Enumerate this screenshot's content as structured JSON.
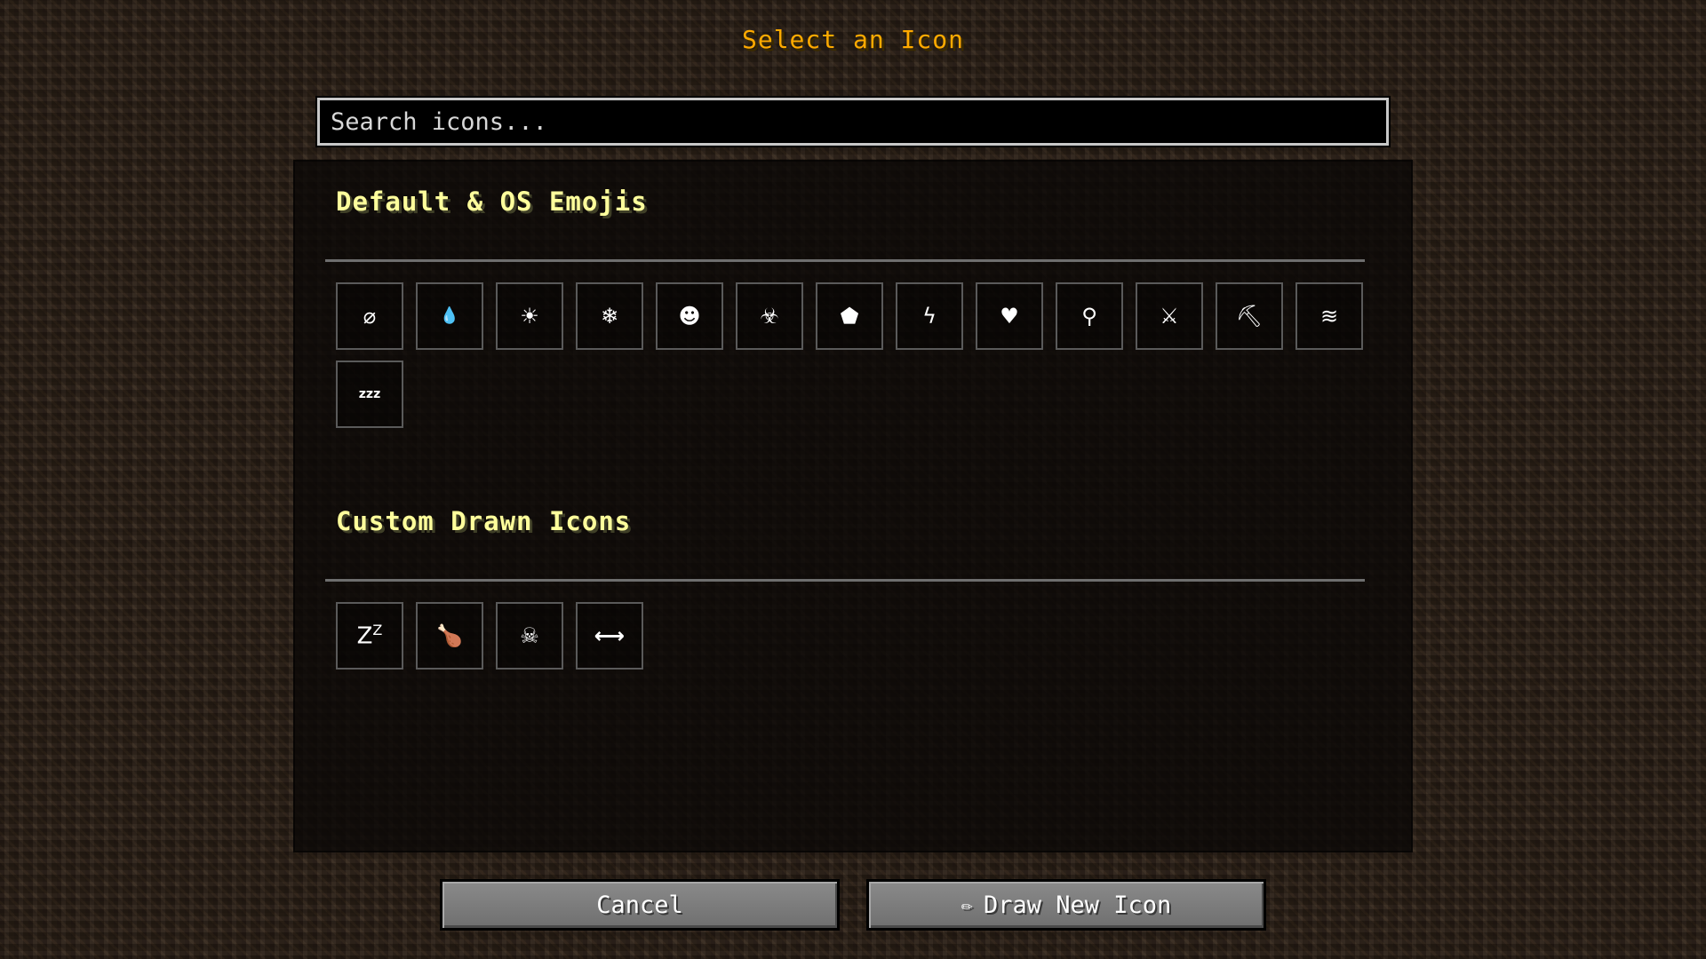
{
  "header": {
    "title": "Select an Icon",
    "title_color": "#ffaa00"
  },
  "search": {
    "placeholder": "Search icons..."
  },
  "sections": [
    {
      "title": "Default & OS Emojis",
      "icons": [
        {
          "name": "no-entry-icon",
          "glyph": "⌀"
        },
        {
          "name": "droplet-icon",
          "glyph": "💧"
        },
        {
          "name": "fire-icon",
          "glyph": "☀"
        },
        {
          "name": "snowflake-icon",
          "glyph": "❄"
        },
        {
          "name": "skull-face-icon",
          "glyph": "☻"
        },
        {
          "name": "biohazard-icon",
          "glyph": "☣"
        },
        {
          "name": "shield-icon",
          "glyph": "⬟"
        },
        {
          "name": "lightning-icon",
          "glyph": "ϟ"
        },
        {
          "name": "heart-icon",
          "glyph": "♥"
        },
        {
          "name": "potion-icon",
          "glyph": "⚲"
        },
        {
          "name": "crossed-swords-icon",
          "glyph": "⚔"
        },
        {
          "name": "pickaxe-icon",
          "glyph": "⛏"
        },
        {
          "name": "swimmer-icon",
          "glyph": "≋"
        },
        {
          "name": "sleep-zzz-icon",
          "glyph": "zzz"
        }
      ]
    },
    {
      "title": "Custom Drawn Icons",
      "icons": [
        {
          "name": "sleep-z-icon",
          "glyph": "Z",
          "sup": "Z"
        },
        {
          "name": "meat-icon",
          "glyph": "🍗"
        },
        {
          "name": "skull-icon",
          "glyph": "☠"
        },
        {
          "name": "dumbbell-icon",
          "glyph": "⟷"
        }
      ]
    }
  ],
  "footer": {
    "cancel_label": "Cancel",
    "draw_label": "Draw New Icon",
    "draw_icon": "✏"
  }
}
